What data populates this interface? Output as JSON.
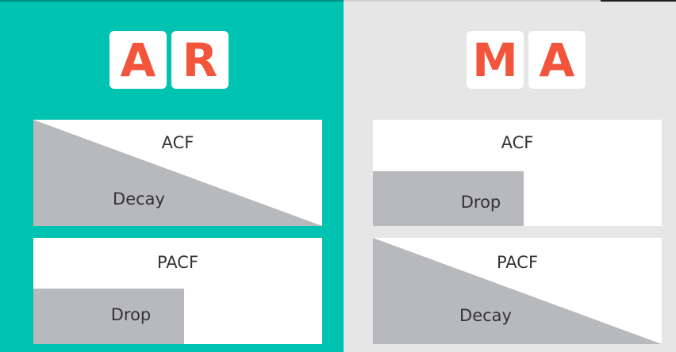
{
  "left_panel": {
    "tiles": [
      "A",
      "R"
    ],
    "acf": {
      "title": "ACF",
      "pattern": "Decay"
    },
    "pacf": {
      "title": "PACF",
      "pattern": "Drop"
    }
  },
  "right_panel": {
    "tiles": [
      "M",
      "A"
    ],
    "acf": {
      "title": "ACF",
      "pattern": "Drop"
    },
    "pacf": {
      "title": "PACF",
      "pattern": "Decay"
    }
  },
  "colors": {
    "left_background": "#00c4b1",
    "right_background": "#e6e6e6",
    "tile_letter": "#f2553c",
    "card_fill": "#ffffff",
    "shape_fill": "#b8b9bc",
    "text": "#333333"
  }
}
